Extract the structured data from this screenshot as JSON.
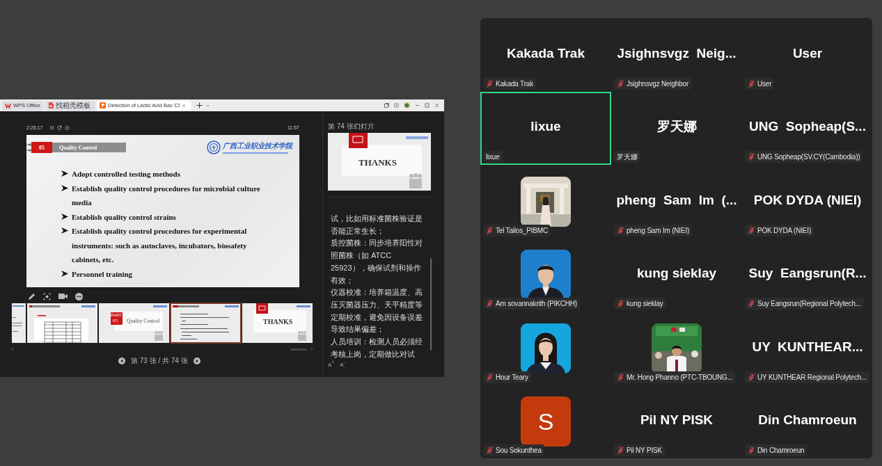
{
  "wps_window": {
    "tabs": [
      {
        "label": "WPS Office",
        "kind": "home",
        "selected": false
      },
      {
        "label": "找稻壳模板",
        "kind": "template",
        "selected": false
      },
      {
        "label": "Detection of Lactic Acid Bac",
        "kind": "document",
        "selected": true
      }
    ],
    "presenter": {
      "elapsed": "2:25:17",
      "clock": "11:57",
      "slide": {
        "part_number": "05",
        "section_title": "Quality Control",
        "logo_text": "广西工业职业技术学院",
        "bullets": [
          "Adopt controlled testing methods",
          "Establish quality control procedures for microbial culture media",
          "Establish quality control strains",
          "Establish quality control procedures for experimental instruments: such as autoclaves, incubators, biosafety cabinets, etc.",
          "Personnel training"
        ]
      },
      "thumbnails": [
        {
          "kind": "partial",
          "selected": false
        },
        {
          "kind": "table",
          "selected": false
        },
        {
          "kind": "section",
          "part": "PART",
          "number": "05",
          "title": "Quality Control",
          "selected": false
        },
        {
          "kind": "bullets",
          "selected": true
        },
        {
          "kind": "thanks",
          "title": "THANKS",
          "selected": false
        }
      ],
      "page_indicator": "第 73 张 / 共 74 张"
    },
    "notes": {
      "next_label": "第 74 张幻灯片",
      "next_title": "THANKS",
      "paragraphs": [
        "试，比如用标准菌株验证是否能正常生长；",
        "质控菌株：同步培养阳性对照菌株（如 ATCC 25923），确保试剂和操作有效；",
        "仪器校准：培养箱温度、高压灭菌器压力、天平精度等定期校准，避免因设备误差导致结果偏差；",
        "人员培训：检测人员必须经考核上岗，定期做比对试"
      ],
      "font_controls": [
        "A$^{+}$",
        "A$^{-}$"
      ]
    }
  },
  "participants": [
    {
      "kind": "name",
      "display": "Kakada Trak",
      "label": "Kakada Trak",
      "muted": true,
      "selected": false
    },
    {
      "kind": "name",
      "display": "Jsighnsvgz  Neig...",
      "label": "Jsighnsvgz Neighbor",
      "muted": true,
      "selected": false
    },
    {
      "kind": "name",
      "display": "User",
      "label": "User",
      "muted": true,
      "selected": false
    },
    {
      "kind": "name",
      "display": "lixue",
      "label": "lixue",
      "muted": false,
      "selected": true
    },
    {
      "kind": "name",
      "display": "罗天娜",
      "label": "罗天娜",
      "muted": false,
      "selected": false
    },
    {
      "kind": "name",
      "display": "UNG  Sopheap(S...",
      "label": "UNG Sopheap(SV.CY(Cambodia))",
      "muted": true,
      "selected": false
    },
    {
      "kind": "picture",
      "label": "Tel Tailos_PIBMC",
      "muted": true,
      "selected": false
    },
    {
      "kind": "name",
      "display": "pheng  Sam  Im  (...",
      "label": "pheng Sam Im (NIEI)",
      "muted": true,
      "selected": false
    },
    {
      "kind": "name",
      "display": "POK DYDA (NIEI)",
      "label": "POK DYDA (NIEI)",
      "muted": true,
      "selected": false
    },
    {
      "kind": "picture",
      "label": "Am sovannakrith (PIKCHH)",
      "muted": true,
      "selected": false
    },
    {
      "kind": "name",
      "display": "kung sieklay",
      "label": "kung sieklay",
      "muted": true,
      "selected": false
    },
    {
      "kind": "name",
      "display": "Suy  Eangsrun(R...",
      "label": "Suy Eangsrun(Regional Polytech...",
      "muted": true,
      "selected": false
    },
    {
      "kind": "picture",
      "label": "Hour Teary",
      "muted": true,
      "selected": false
    },
    {
      "kind": "picture",
      "label": "Mr. Hong Phanno (PTC-TBOUNG...",
      "muted": true,
      "selected": false
    },
    {
      "kind": "name",
      "display": "UY  KUNTHEAR...",
      "label": "UY KUNTHEAR Regional Polytech...",
      "muted": true,
      "selected": false
    },
    {
      "kind": "avatar",
      "initial": "S",
      "label": "Sou Sokunthea",
      "muted": true,
      "selected": false
    },
    {
      "kind": "name",
      "display": "Pil NY PISK",
      "label": "Pil NY PISK",
      "muted": true,
      "selected": false
    },
    {
      "kind": "name",
      "display": "Din Chamroeun",
      "label": "Din Chamroeun",
      "muted": true,
      "selected": false
    }
  ]
}
